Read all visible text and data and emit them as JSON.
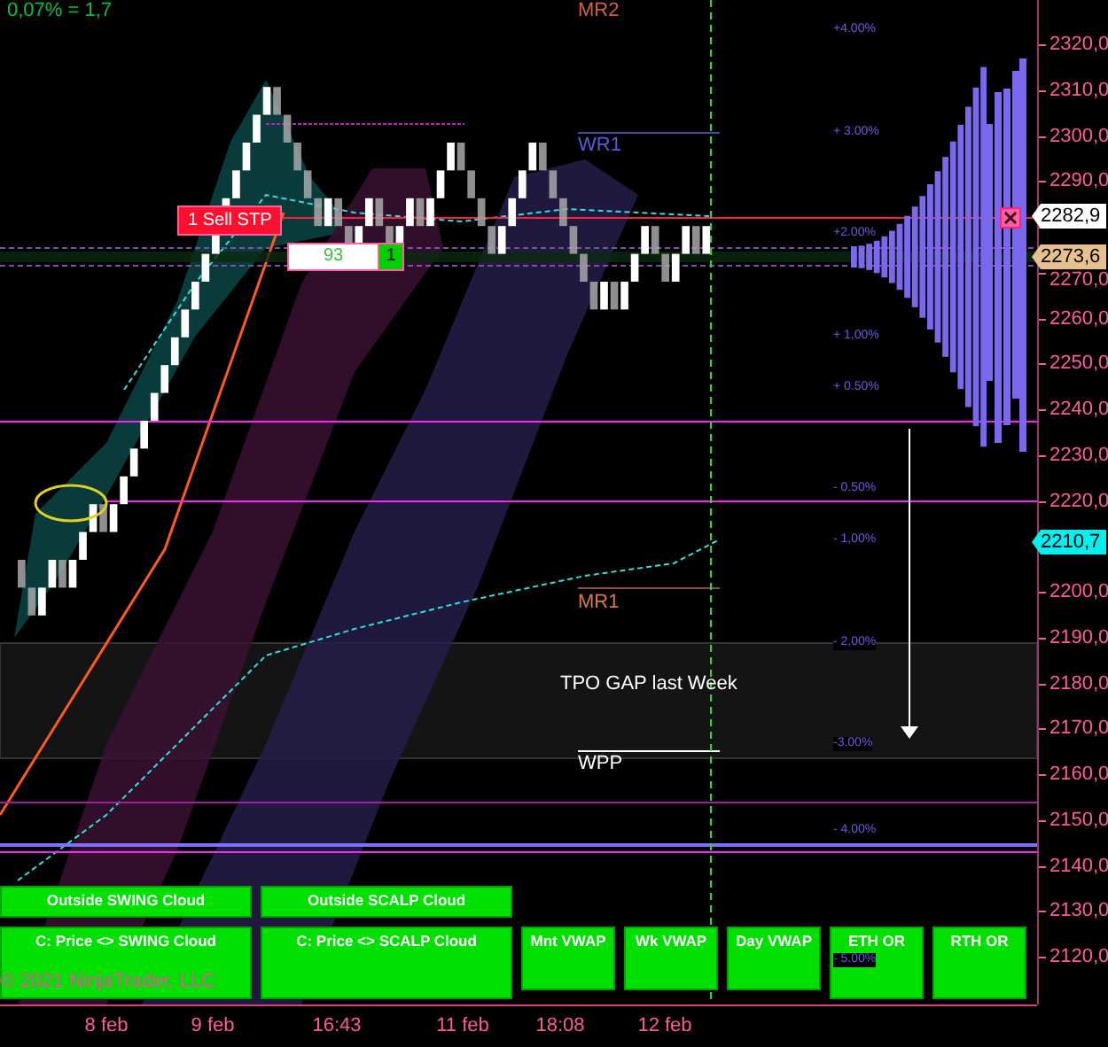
{
  "top_note": "0,07% = 1,7",
  "pivot_labels": [
    {
      "text": "MR2",
      "color": "#d06040"
    },
    {
      "text": "WR1",
      "color": "#5a5ad8"
    },
    {
      "text": "MR1",
      "color": "#d87848"
    },
    {
      "text": "WPP",
      "color": "#ffffff"
    }
  ],
  "zone_label": "TPO GAP last Week",
  "percent_labels": [
    "+4.00%",
    "+ 3.00%",
    "+2.00%",
    "+ 1,00%",
    "+ 0.50%",
    "- 0.50%",
    "- 1,00%",
    "- 2,00%",
    "-3.00%",
    "- 4.00%",
    "- 5.00%"
  ],
  "order": {
    "label": "1 Sell STP",
    "quantity": "93",
    "count": "1"
  },
  "price_tags": [
    {
      "text": "2282,9",
      "kind": "last"
    },
    {
      "text": "2273,6",
      "kind": "poc"
    },
    {
      "text": "2210,7",
      "kind": "vwap"
    }
  ],
  "price_axis": [
    "2320,0",
    "2310,0",
    "2300,0",
    "2290,0",
    "2270,0",
    "2260,0",
    "2250,0",
    "2240,0",
    "2230,0",
    "2220,0",
    "2200,0",
    "2190,0",
    "2180,0",
    "2170,0",
    "2160,0",
    "2150,0",
    "2140,0",
    "2130,0",
    "2120,0"
  ],
  "time_axis": [
    "8 feb",
    "9 feb",
    "16:43",
    "11 feb",
    "18:08",
    "12 feb"
  ],
  "signal_rows": [
    {
      "buttons": [
        {
          "label": "Outside SWING Cloud",
          "kind": "wide"
        },
        {
          "label": "Outside SCALP Cloud",
          "kind": "wide"
        }
      ]
    },
    {
      "buttons": [
        {
          "label": "C: Price <> SWING Cloud",
          "kind": "wide"
        },
        {
          "label": "C: Price <> SCALP Cloud",
          "kind": "wide"
        },
        {
          "label": "Mnt VWAP",
          "kind": "short"
        },
        {
          "label": "Wk VWAP",
          "kind": "short"
        },
        {
          "label": "Day VWAP",
          "kind": "short"
        },
        {
          "label": "ETH OR",
          "kind": "narrow"
        },
        {
          "label": "RTH OR",
          "kind": "narrow"
        }
      ]
    }
  ],
  "copyright": "© 2021 NinjaTrader, LLC"
}
